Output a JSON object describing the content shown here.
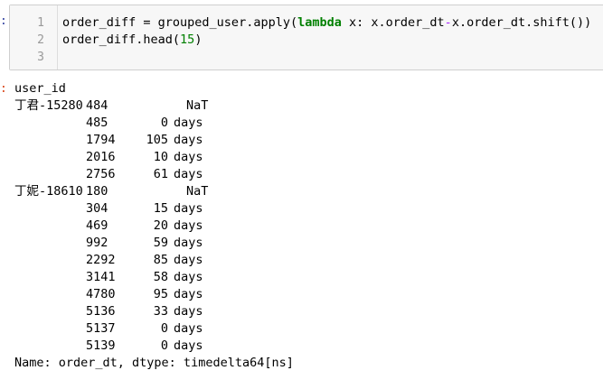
{
  "input": {
    "line_numbers": [
      "1",
      "2",
      "3"
    ],
    "line1": {
      "prefix": "order_diff = grouped_user.apply(",
      "keyword": "lambda",
      "mid": " x: x.order_dt",
      "op": "-",
      "suffix": "x.order_dt.shift())"
    },
    "line2": {
      "prefix": "order_diff.head(",
      "number": "15",
      "suffix": ")"
    }
  },
  "output": {
    "header": "user_id",
    "nat_label": "NaT",
    "days_unit": "days",
    "rows": [
      {
        "user": "丁君-15280",
        "order": "484",
        "diff": "NaT"
      },
      {
        "user": "",
        "order": "485",
        "diff": "0"
      },
      {
        "user": "",
        "order": "1794",
        "diff": "105"
      },
      {
        "user": "",
        "order": "2016",
        "diff": "10"
      },
      {
        "user": "",
        "order": "2756",
        "diff": "61"
      },
      {
        "user": "丁妮-18610",
        "order": "180",
        "diff": "NaT"
      },
      {
        "user": "",
        "order": "304",
        "diff": "15"
      },
      {
        "user": "",
        "order": "469",
        "diff": "20"
      },
      {
        "user": "",
        "order": "992",
        "diff": "59"
      },
      {
        "user": "",
        "order": "2292",
        "diff": "85"
      },
      {
        "user": "",
        "order": "3141",
        "diff": "58"
      },
      {
        "user": "",
        "order": "4780",
        "diff": "95"
      },
      {
        "user": "",
        "order": "5136",
        "diff": "33"
      },
      {
        "user": "",
        "order": "5137",
        "diff": "0"
      },
      {
        "user": "",
        "order": "5139",
        "diff": "0"
      }
    ],
    "footer": "Name: order_dt, dtype: timedelta64[ns]"
  }
}
